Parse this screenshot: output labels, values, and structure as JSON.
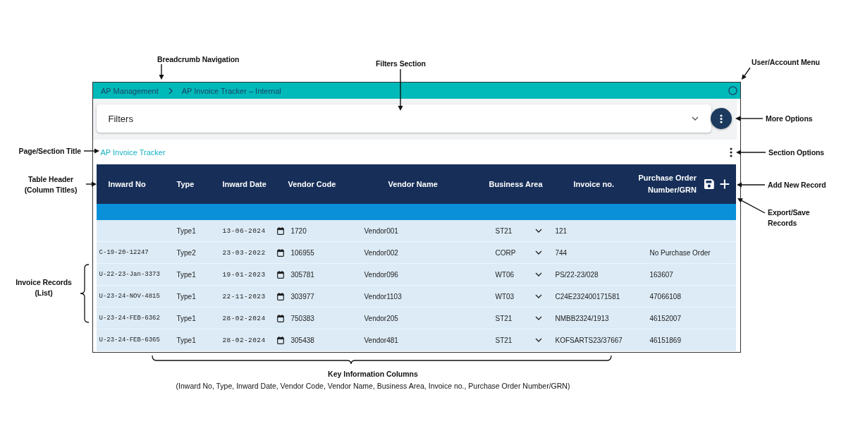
{
  "breadcrumb": [
    {
      "label": "AP Management"
    },
    {
      "label": "AP Invoice Tracker – Internal"
    }
  ],
  "filters": {
    "label": "Filters",
    "expanded": false
  },
  "section": {
    "title": "AP Invoice Tracker"
  },
  "table": {
    "columns": [
      {
        "label": "Inward No",
        "kind": "code"
      },
      {
        "label": "Type",
        "kind": "text"
      },
      {
        "label": "Inward Date",
        "kind": "date"
      },
      {
        "label": "Vendor Code",
        "kind": "text"
      },
      {
        "label": "Vendor Name",
        "kind": "text"
      },
      {
        "label": "Business Area",
        "kind": "select"
      },
      {
        "label": "Invoice no.",
        "kind": "text"
      },
      {
        "label": "Purchase Order Number/GRN",
        "kind": "text"
      }
    ],
    "rows": [
      {
        "type": "Type1",
        "inward_date": "13-06-2024",
        "vendor_code": "1720",
        "vendor_name": "Vendor001",
        "business_area": "ST21",
        "invoice_no": "121"
      },
      {
        "inward_no": "C-19-20-12247",
        "type": "Type2",
        "inward_date": "23-03-2022",
        "vendor_code": "106955",
        "vendor_name": "Vendor002",
        "business_area": "CORP",
        "invoice_no": "744",
        "purchase_order": "No Purchase Order"
      },
      {
        "inward_no": "U-22-23-Jan-3373",
        "type": "Type1",
        "inward_date": "19-01-2023",
        "vendor_code": "305781",
        "vendor_name": "Vendor096",
        "business_area": "WT06",
        "invoice_no": "PS/22-23/028",
        "purchase_order": "163607"
      },
      {
        "inward_no": "U-23-24-NOV-4815",
        "type": "Type1",
        "inward_date": "22-11-2023",
        "vendor_code": "303977",
        "vendor_name": "Vendor1103",
        "business_area": "WT03",
        "invoice_no": "C24E232400171581",
        "purchase_order": "47066108"
      },
      {
        "inward_no": "U-23-24-FEB-6362",
        "type": "Type1",
        "inward_date": "28-02-2024",
        "vendor_code": "750383",
        "vendor_name": "Vendor205",
        "business_area": "ST21",
        "invoice_no": "NMBB2324/1913",
        "purchase_order": "46152007"
      },
      {
        "inward_no": "U-23-24-FEB-6365",
        "type": "Type1",
        "inward_date": "28-02-2024",
        "vendor_code": "305438",
        "vendor_name": "Vendor481",
        "business_area": "ST21",
        "invoice_no": "KOFSARTS23/37667",
        "purchase_order": "46151869"
      }
    ]
  },
  "callouts": [
    {
      "kind": "arrow",
      "text": "Breadcrumb Navigation"
    },
    {
      "kind": "arrow",
      "text": "Filters Section"
    },
    {
      "kind": "arrow",
      "text": "User/Account Menu"
    },
    {
      "kind": "arrow",
      "text": "More Options"
    },
    {
      "kind": "arrow",
      "text": "Page/Section Title"
    },
    {
      "kind": "arrow",
      "text": "Section Options"
    },
    {
      "kind": "arrow",
      "text": "Table Header (Column Titles)"
    },
    {
      "kind": "arrow",
      "text": "Add New Record"
    },
    {
      "kind": "arrow",
      "text": "Export/Save Records"
    },
    {
      "kind": "brace",
      "text": "Invoice Records (List)"
    }
  ],
  "columns_note": {
    "title": "Key Information Columns",
    "detail": "(Inward No, Type, Inward Date, Vendor Code, Vendor Name, Business Area, Invoice no., Purchase Order Number/GRN)"
  }
}
